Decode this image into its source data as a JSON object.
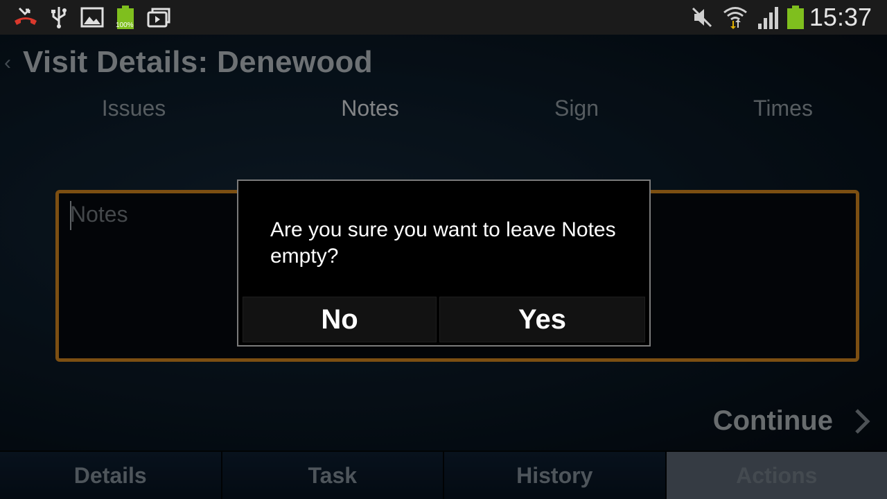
{
  "status_bar": {
    "time": "15:37",
    "battery_text": "100%",
    "icons": [
      "missed-call-icon",
      "usb-icon",
      "gallery-icon",
      "battery-charging-icon",
      "media-icon",
      "mute-icon",
      "wifi-icon",
      "signal-icon",
      "battery-icon"
    ]
  },
  "header": {
    "title": "Visit Details: Denewood",
    "back_glyph": "‹"
  },
  "tabs": [
    {
      "label": "Issues",
      "active": false
    },
    {
      "label": "Notes",
      "active": true
    },
    {
      "label": "Sign",
      "active": false
    },
    {
      "label": "Times",
      "active": false
    }
  ],
  "notes_field": {
    "placeholder": "Notes",
    "value": ""
  },
  "continue_label": "Continue",
  "bottom_nav": [
    {
      "label": "Details",
      "active": false
    },
    {
      "label": "Task",
      "active": false
    },
    {
      "label": "History",
      "active": false
    },
    {
      "label": "Actions",
      "active": true
    }
  ],
  "dialog": {
    "message": "Are you sure you want to leave Notes empty?",
    "no_label": "No",
    "yes_label": "Yes"
  },
  "colors": {
    "accent_orange": "#c9801e",
    "battery_green": "#7fbf1e",
    "missed_call_red": "#d9382c",
    "wifi_arrow_yellow": "#e0b000"
  }
}
